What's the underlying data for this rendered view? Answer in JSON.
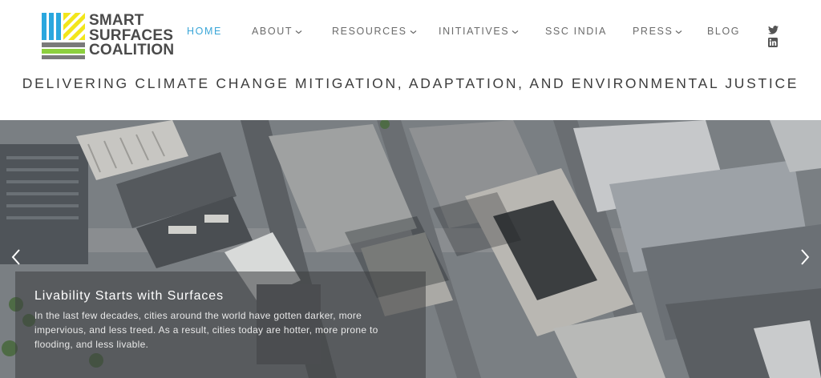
{
  "logo": {
    "line1": "SMART",
    "line2": "SURFACES",
    "line3": "COALITION",
    "colors": {
      "blue": "#2aa7de",
      "yellow": "#f2e61b",
      "green": "#8ccf3e",
      "grey": "#7a7a7a"
    }
  },
  "nav": {
    "items": [
      {
        "label": "HOME",
        "active": true,
        "dropdown": false
      },
      {
        "label": "ABOUT",
        "active": false,
        "dropdown": true
      },
      {
        "label": "RESOURCES",
        "active": false,
        "dropdown": true
      },
      {
        "label": "INITIATIVES",
        "active": false,
        "dropdown": true
      },
      {
        "label": "SSC INDIA",
        "active": false,
        "dropdown": false
      },
      {
        "label": "PRESS",
        "active": false,
        "dropdown": true
      },
      {
        "label": "BLOG",
        "active": false,
        "dropdown": false
      }
    ],
    "active_color": "#3aa6d8"
  },
  "social": {
    "icons": [
      "twitter-icon",
      "linkedin-icon"
    ]
  },
  "tagline": "DELIVERING CLIMATE CHANGE MITIGATION, ADAPTATION, AND ENVIRONMENTAL JUSTICE",
  "hero": {
    "caption_title": "Livability Starts with Surfaces",
    "caption_body": "In the last few decades, cities around the world have gotten darker, more impervious, and less treed. As a result, cities today are hotter, more prone to flooding, and less livable.",
    "prev_icon": "chevron-left-icon",
    "next_icon": "chevron-right-icon"
  }
}
